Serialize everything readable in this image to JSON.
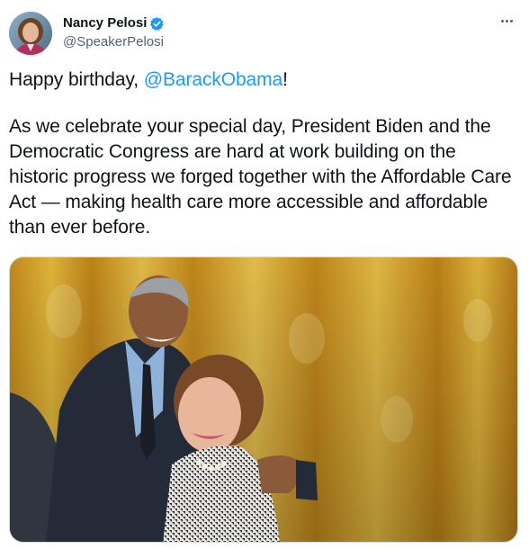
{
  "tweet": {
    "author": {
      "display_name": "Nancy Pelosi",
      "handle": "@SpeakerPelosi",
      "verified": true,
      "avatar_icon": "profile-photo"
    },
    "more_icon": "more-horizontal-icon",
    "text": {
      "line1_prefix": "Happy birthday, ",
      "line1_mention": "@BarackObama",
      "line1_suffix": "!",
      "paragraph2": "As we celebrate your special day, President Biden and the Democratic Congress are hard at work building on the historic progress we forged together with the Affordable Care Act — making health care more accessible and affordable than ever before."
    },
    "media": {
      "type": "photo"
    }
  },
  "colors": {
    "text": "#0f1419",
    "secondary": "#536471",
    "link": "#1d9bf0",
    "verified": "#1d9bf0",
    "curtain": "#d9a82a"
  }
}
